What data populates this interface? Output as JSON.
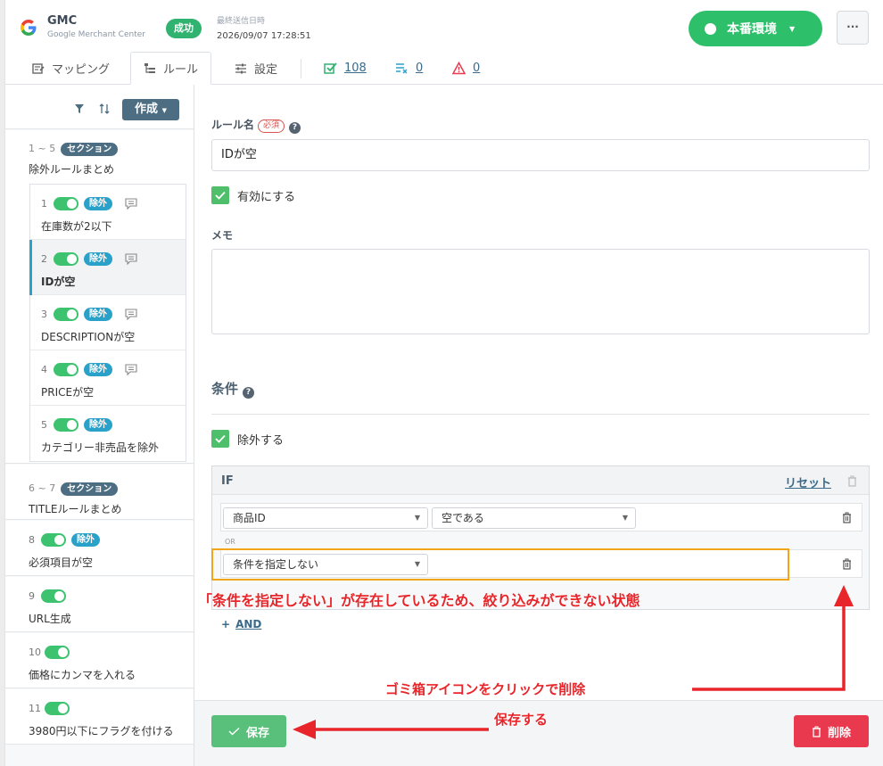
{
  "header": {
    "app_name": "GMC",
    "app_sub": "Google Merchant Center",
    "status": "成功",
    "last_sent_label": "最終送信日時",
    "last_sent_value": "2026/09/07 17:28:51",
    "env_label": "本番環境",
    "more_label": "···"
  },
  "tabs": [
    {
      "label": "マッピング"
    },
    {
      "label": "ルール"
    },
    {
      "label": "設定"
    }
  ],
  "stats": [
    {
      "icon": "check-list-icon",
      "value": "108"
    },
    {
      "icon": "x-list-icon",
      "value": "0"
    },
    {
      "icon": "warning-icon",
      "value": "0"
    }
  ],
  "sidebar": {
    "create_label": "作成",
    "groups": [
      {
        "range": "1 ~ 5",
        "badge": "セクション",
        "title": "除外ルールまとめ",
        "rules": [
          {
            "num": "1",
            "badge": "除外",
            "title": "在庫数が2以下"
          },
          {
            "num": "2",
            "badge": "除外",
            "title": "IDが空"
          },
          {
            "num": "3",
            "badge": "除外",
            "title": "DESCRIPTIONが空"
          },
          {
            "num": "4",
            "badge": "除外",
            "title": "PRICEが空"
          },
          {
            "num": "5",
            "badge": "除外",
            "title": "カテゴリー非売品を除外"
          }
        ]
      },
      {
        "range": "6 ~ 7",
        "badge": "セクション",
        "title": "TITLEルールまとめ"
      }
    ],
    "items": [
      {
        "num": "8",
        "badge": "除外",
        "title": "必須項目が空"
      },
      {
        "num": "9",
        "title": "URL生成"
      },
      {
        "num": "10",
        "title": "価格にカンマを入れる"
      },
      {
        "num": "11",
        "title": "3980円以下にフラグを付ける"
      }
    ]
  },
  "form": {
    "rule_name_label": "ルール名",
    "required_badge": "必須",
    "rule_name_value": "IDが空",
    "enable_label": "有効にする",
    "memo_label": "メモ",
    "memo_value": "",
    "conditions_title": "条件",
    "exclude_label": "除外する",
    "if_label": "IF",
    "reset_label": "リセット",
    "row1_field": "商品ID",
    "row1_op": "空である",
    "or_label": "OR",
    "row2_field": "条件を指定しない",
    "and_label": "AND",
    "save_label": "保存",
    "delete_label": "削除"
  },
  "annotations": {
    "note_unspecified": "「条件を指定しない」が存在しているため、絞り込みができない状態",
    "note_trash": "ゴミ箱アイコンをクリックで削除",
    "note_save": "保存する"
  },
  "colors": {
    "accent_green": "#2ebf6a",
    "section_badge": "#4d6e82",
    "exclude_badge": "#2aa1c9",
    "delete_red": "#e8394e",
    "annotation_red": "#e8252a",
    "annotation_box": "#f0a51b"
  }
}
